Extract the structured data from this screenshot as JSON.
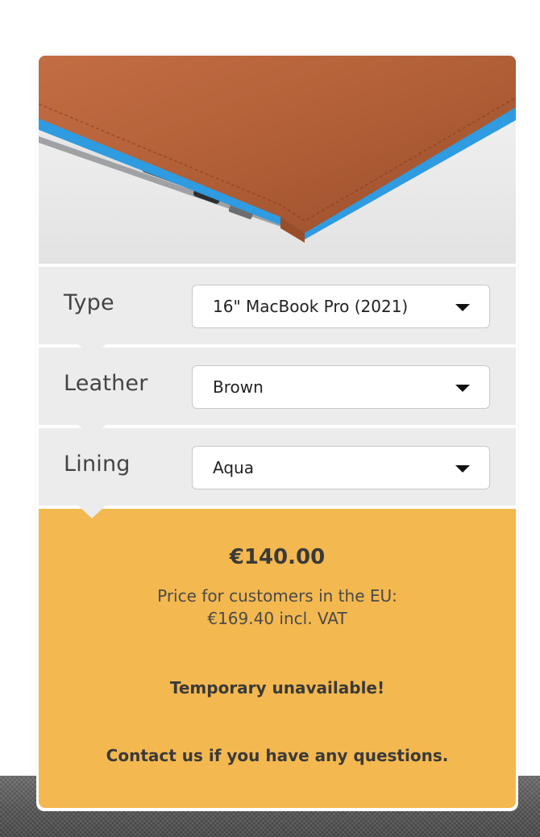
{
  "product_image": {
    "alt": "",
    "colors": {
      "leather": "#b8623a",
      "lining": "#2f9be0",
      "background": "#ececec"
    }
  },
  "options": [
    {
      "label": "Type",
      "value": "16\" MacBook Pro (2021)"
    },
    {
      "label": "Leather",
      "value": "Brown"
    },
    {
      "label": "Lining",
      "value": "Aqua"
    }
  ],
  "pricing": {
    "price": "€140.00",
    "eu_line_1": "Price for customers in the EU:",
    "eu_line_2": "€169.40 incl. VAT",
    "availability": "Temporary unavailable!",
    "contact": "Contact us if you have any questions."
  },
  "colors": {
    "panel": "#ececec",
    "price_panel": "#f3b84f"
  }
}
